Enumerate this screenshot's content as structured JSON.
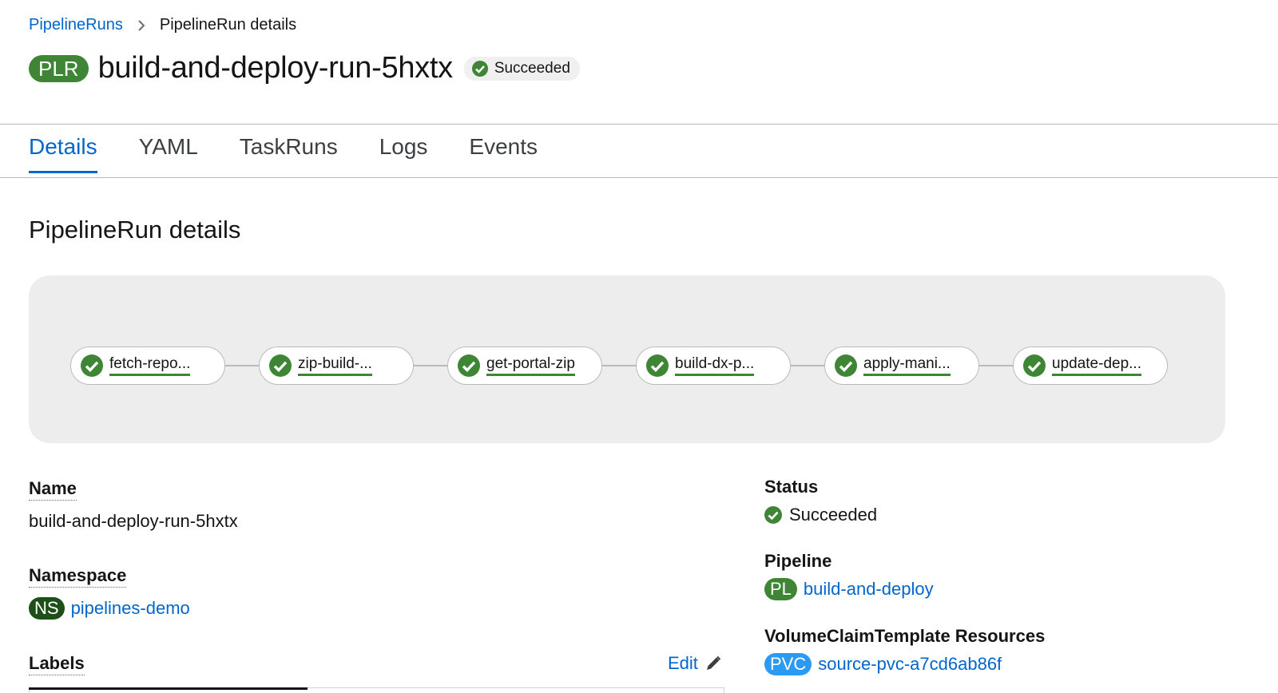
{
  "breadcrumb": {
    "parent": "PipelineRuns",
    "current": "PipelineRun details"
  },
  "header": {
    "badge": "PLR",
    "title": "build-and-deploy-run-5hxtx",
    "status": "Succeeded"
  },
  "tabs": [
    {
      "label": "Details"
    },
    {
      "label": "YAML"
    },
    {
      "label": "TaskRuns"
    },
    {
      "label": "Logs"
    },
    {
      "label": "Events"
    }
  ],
  "section_title": "PipelineRun details",
  "pipeline_graph": {
    "tasks": [
      {
        "label": "fetch-repo...",
        "status": "succeeded"
      },
      {
        "label": "zip-build-...",
        "status": "succeeded"
      },
      {
        "label": "get-portal-zip",
        "status": "succeeded"
      },
      {
        "label": "build-dx-p...",
        "status": "succeeded"
      },
      {
        "label": "apply-mani...",
        "status": "succeeded"
      },
      {
        "label": "update-dep...",
        "status": "succeeded"
      }
    ]
  },
  "details": {
    "name_label": "Name",
    "name_value": "build-and-deploy-run-5hxtx",
    "namespace_label": "Namespace",
    "namespace_badge": "NS",
    "namespace_value": "pipelines-demo",
    "labels_label": "Labels",
    "edit_label": "Edit",
    "status_label": "Status",
    "status_value": "Succeeded",
    "pipeline_label": "Pipeline",
    "pipeline_badge": "PL",
    "pipeline_value": "build-and-deploy",
    "vct_label": "VolumeClaimTemplate Resources",
    "vct_badge": "PVC",
    "vct_value": "source-pvc-a7cd6ab86f"
  },
  "colors": {
    "link": "#0066cc",
    "success": "#3e8635",
    "pvc": "#2b9af3",
    "ns": "#1e4f18"
  },
  "icons": [
    "chevron-right-icon",
    "check-circle-icon",
    "pencil-icon"
  ]
}
